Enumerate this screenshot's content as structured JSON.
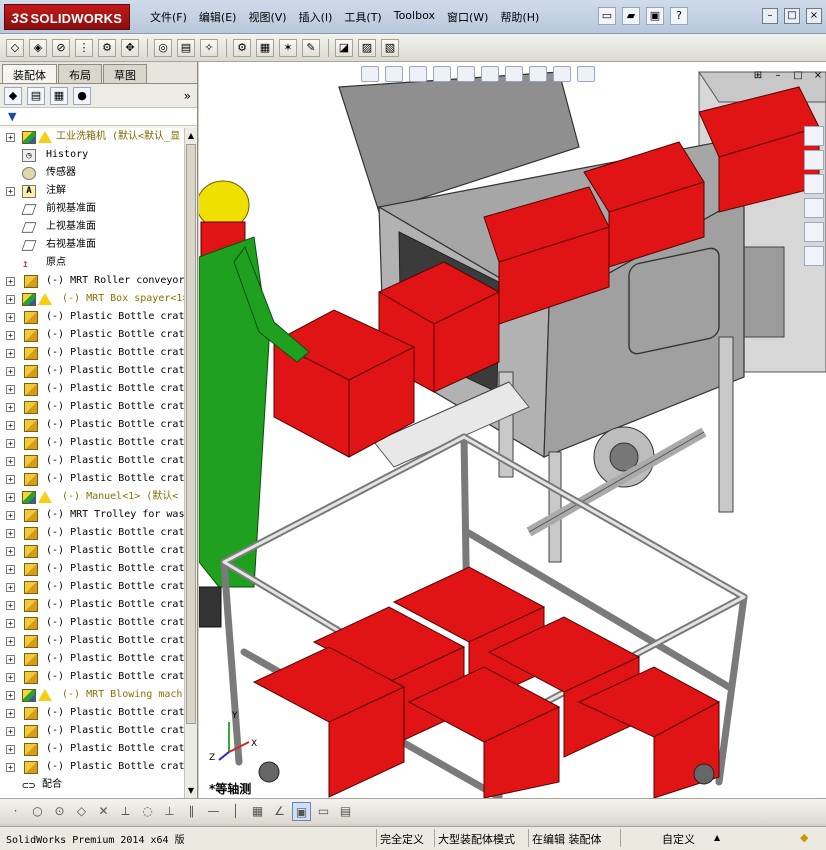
{
  "app": {
    "brand": "SOLIDWORKS",
    "brand_prefix": "3S"
  },
  "menu": [
    "文件(F)",
    "编辑(E)",
    "视图(V)",
    "插入(I)",
    "工具(T)",
    "Toolbox",
    "窗口(W)",
    "帮助(H)"
  ],
  "panel": {
    "tabs": [
      "装配体",
      "布局",
      "草图"
    ],
    "active_tab": 0,
    "more": "»"
  },
  "tree": [
    {
      "type": "top",
      "text": "工业洗箱机  (默认<默认_显",
      "warn": true,
      "expand": "+"
    },
    {
      "type": "sub",
      "icon": "hist",
      "text": "History"
    },
    {
      "type": "sub",
      "icon": "sensor",
      "text": "传感器"
    },
    {
      "type": "sub",
      "icon": "note",
      "text": "注解",
      "expand": "+"
    },
    {
      "type": "sub",
      "icon": "plane",
      "text": "前视基准面"
    },
    {
      "type": "sub",
      "icon": "plane",
      "text": "上视基准面"
    },
    {
      "type": "sub",
      "icon": "plane",
      "text": "右视基准面"
    },
    {
      "type": "sub",
      "icon": "origin",
      "text": "原点"
    },
    {
      "type": "comp",
      "text": "(-) MRT Roller conveyor"
    },
    {
      "type": "warn",
      "text": "(-) MRT Box spayer<1>"
    },
    {
      "type": "comp",
      "text": "(-) Plastic Bottle crat"
    },
    {
      "type": "comp",
      "text": "(-) Plastic Bottle crat"
    },
    {
      "type": "comp",
      "text": "(-) Plastic Bottle crat"
    },
    {
      "type": "comp",
      "text": "(-) Plastic Bottle crat"
    },
    {
      "type": "comp",
      "text": "(-) Plastic Bottle crat"
    },
    {
      "type": "comp",
      "text": "(-) Plastic Bottle crat"
    },
    {
      "type": "comp",
      "text": "(-) Plastic Bottle crat"
    },
    {
      "type": "comp",
      "text": "(-) Plastic Bottle crat"
    },
    {
      "type": "comp",
      "text": "(-) Plastic Bottle crat"
    },
    {
      "type": "comp",
      "text": "(-) Plastic Bottle crat"
    },
    {
      "type": "warn",
      "text": "(-) Manuel<1> (默认<"
    },
    {
      "type": "comp",
      "text": "(-) MRT Trolley for was"
    },
    {
      "type": "comp",
      "text": "(-) Plastic Bottle crat"
    },
    {
      "type": "comp",
      "text": "(-) Plastic Bottle crat"
    },
    {
      "type": "comp",
      "text": "(-) Plastic Bottle crat"
    },
    {
      "type": "comp",
      "text": "(-) Plastic Bottle crat"
    },
    {
      "type": "comp",
      "text": "(-) Plastic Bottle crat"
    },
    {
      "type": "comp",
      "text": "(-) Plastic Bottle crat"
    },
    {
      "type": "comp",
      "text": "(-) Plastic Bottle crat"
    },
    {
      "type": "comp",
      "text": "(-) Plastic Bottle crat"
    },
    {
      "type": "comp",
      "text": "(-) Plastic Bottle crat"
    },
    {
      "type": "warn",
      "text": "(-) MRT Blowing mach"
    },
    {
      "type": "comp",
      "text": "(-) Plastic Bottle crat"
    },
    {
      "type": "comp",
      "text": "(-) Plastic Bottle crat"
    },
    {
      "type": "comp",
      "text": "(-) Plastic Bottle crat"
    },
    {
      "type": "comp",
      "text": "(-) Plastic Bottle crat"
    },
    {
      "type": "mate",
      "text": "配合"
    }
  ],
  "viewport": {
    "view_label": "*等轴测",
    "triad": {
      "x": "X",
      "y": "Y",
      "z": "Z"
    }
  },
  "status": {
    "product": "SolidWorks Premium 2014 x64 版",
    "definition": "完全定义",
    "mode": "大型装配体模式",
    "editing": "在编辑 装配体",
    "custom": "自定义",
    "custom_arrow": "▲"
  },
  "colors": {
    "crate_red": "#e01414",
    "frame_gray": "#b4b4b4",
    "worker_green": "#1fa01f",
    "helmet_yellow": "#f0e000"
  }
}
